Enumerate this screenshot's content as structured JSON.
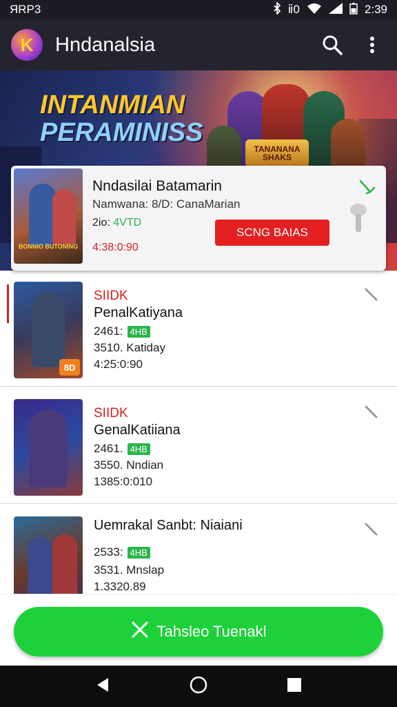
{
  "status_bar": {
    "left_text": "ЯRP3",
    "right_text": "ⅱ0",
    "time": "2:39"
  },
  "app_bar": {
    "title": "Hndanalsia",
    "logo_letter": "K",
    "icons": [
      "search-icon",
      "more-vert-icon"
    ]
  },
  "banner": {
    "title_line1": "INTANMIAN",
    "title_line2": "PERAMINISS",
    "badge_text": "TANANANA SHAKS"
  },
  "featured": {
    "title": "Nndasilai Batamarin",
    "subtitle": "Namwana: 8/D: CanaMarian",
    "meta_prefix": "2io:",
    "meta_green": "4VTD",
    "red_text": "4:38:0:90",
    "button_label": "SCNG BAIAS",
    "poster_caption": "BONNIO BUTONING"
  },
  "list": [
    {
      "title1": "SIIDK",
      "title2": "PenalKatiyana",
      "m1_prefix": "2461:",
      "m1_tag": "4HB",
      "m2": "3510. Katiday",
      "m3": "4:25:0:90",
      "thumb_badge": "8D"
    },
    {
      "title1": "SIIDK",
      "title2": "GenalKatiiana",
      "m1_prefix": "2461.",
      "m1_tag": "4HB",
      "m2": "3550. Nndian",
      "m3": "1385:0:010"
    },
    {
      "title1": "",
      "title2": "Uemrakal Sanbt: Niaiani",
      "m1_prefix": "2533:",
      "m1_tag": "4HB",
      "m2": "3531. Mnslap",
      "m3": "1.3320.89"
    }
  ],
  "fab": {
    "label": "Tahsleo Tuenakl",
    "icon": "close-x-icon"
  },
  "nav": {
    "icons": [
      "back-icon",
      "home-icon",
      "recents-icon"
    ]
  },
  "colors": {
    "accent_red": "#e41f1f",
    "accent_green": "#1ed13a",
    "appbar": "#24242e"
  }
}
